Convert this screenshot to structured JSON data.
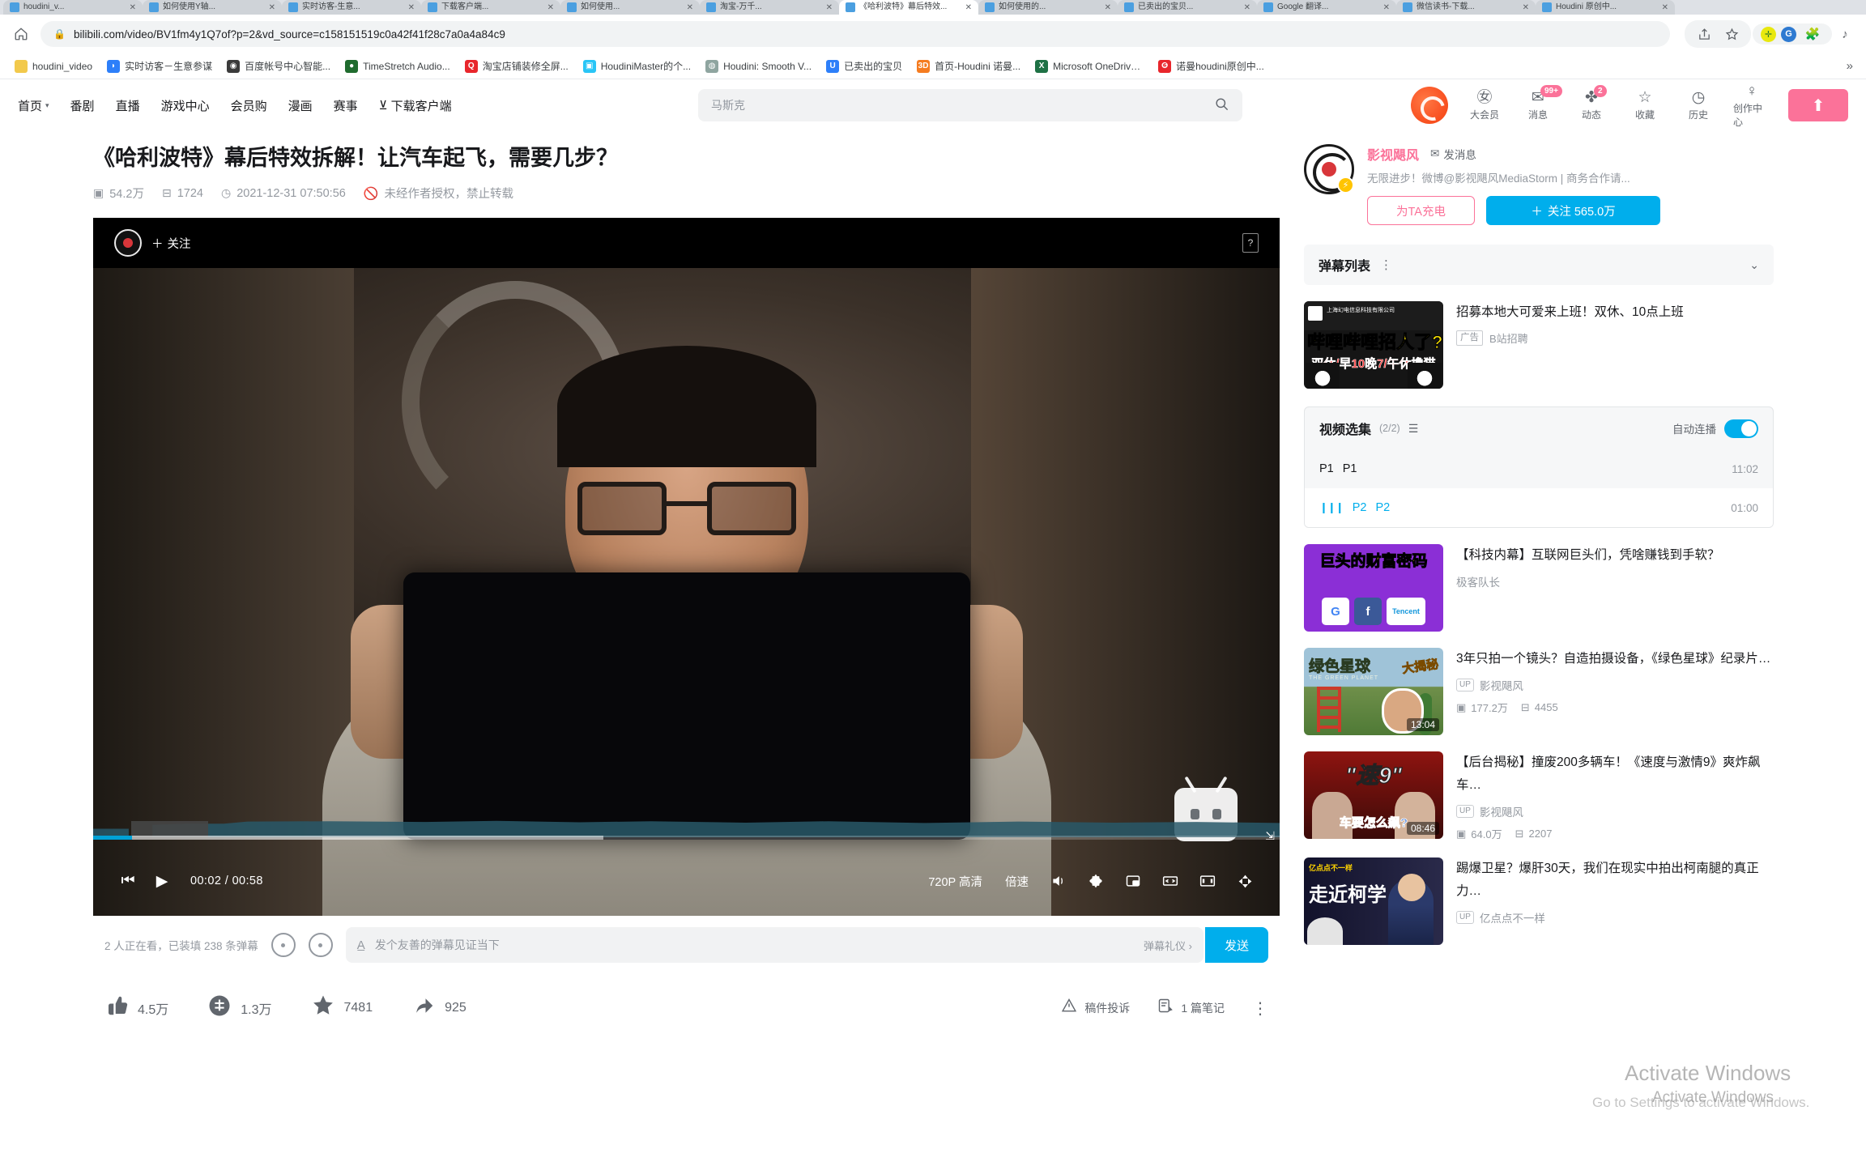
{
  "browser": {
    "tabs": [
      {
        "title": "houdini_v...",
        "active": false
      },
      {
        "title": "如何使用Y轴...",
        "active": false
      },
      {
        "title": "实时访客-生意...",
        "active": false
      },
      {
        "title": "下载客户端...",
        "active": false
      },
      {
        "title": "如何使用...",
        "active": false
      },
      {
        "title": "淘宝-万千...",
        "active": false
      },
      {
        "title": "《哈利波特》幕后特效...",
        "active": true
      },
      {
        "title": "如何使用的...",
        "active": false
      },
      {
        "title": "已卖出的宝贝...",
        "active": false
      },
      {
        "title": "Google 翻译...",
        "active": false
      },
      {
        "title": "微信读书-下载...",
        "active": false
      },
      {
        "title": "Houdini 原创中...",
        "active": false
      }
    ],
    "url": "bilibili.com/video/BV1fm4y1Q7of?p=2&vd_source=c158151519c0a42f41f28c7a0a4a84c9",
    "bookmarks": [
      {
        "label": "houdini_video",
        "color": "#f2c94c",
        "glyph": ""
      },
      {
        "label": "实时访客－生意参谋",
        "color": "#2d7ff9",
        "glyph": "◗"
      },
      {
        "label": "百度帐号中心智能...",
        "color": "#3b3b3b",
        "glyph": "◉"
      },
      {
        "label": "TimeStretch Audio...",
        "color": "#1f6b2e",
        "glyph": "●"
      },
      {
        "label": "淘宝店铺装修全屏...",
        "color": "#e8262c",
        "glyph": "Q"
      },
      {
        "label": "HoudiniMaster的个...",
        "color": "#29c5f6",
        "glyph": "▣"
      },
      {
        "label": "Houdini: Smooth V...",
        "color": "#8fa5a0",
        "glyph": "◍"
      },
      {
        "label": "已卖出的宝贝",
        "color": "#2d7ff9",
        "glyph": "U"
      },
      {
        "label": "首页-Houdini 诺曼...",
        "color": "#f57c20",
        "glyph": "3D"
      },
      {
        "label": "Microsoft OneDrive...",
        "color": "#1e7145",
        "glyph": "X"
      },
      {
        "label": "诺曼houdini原创中...",
        "color": "#e8262c",
        "glyph": "❻"
      }
    ],
    "overflow": "»"
  },
  "bili_header": {
    "nav": [
      {
        "label": "首页",
        "caret": true
      },
      {
        "label": "番剧",
        "caret": false
      },
      {
        "label": "直播",
        "caret": false
      },
      {
        "label": "游戏中心",
        "caret": false
      },
      {
        "label": "会员购",
        "caret": false
      },
      {
        "label": "漫画",
        "caret": false
      },
      {
        "label": "赛事",
        "caret": false
      }
    ],
    "download_label": "下载客户端",
    "search_value": "马斯克",
    "right_items": [
      {
        "label": "大会员",
        "glyph": "㊛",
        "badge": ""
      },
      {
        "label": "消息",
        "glyph": "✉",
        "badge": "99+"
      },
      {
        "label": "动态",
        "glyph": "✤",
        "badge": "2"
      },
      {
        "label": "收藏",
        "glyph": "☆",
        "badge": ""
      },
      {
        "label": "历史",
        "glyph": "◷",
        "badge": ""
      },
      {
        "label": "创作中心",
        "glyph": "♀",
        "badge": ""
      }
    ],
    "upload_glyph": "⬆"
  },
  "video": {
    "title": "《哈利波特》幕后特效拆解！让汽车起飞，需要几步？",
    "views": "54.2万",
    "danmaku": "1724",
    "date": "2021-12-31 07:50:56",
    "copyright": "未经作者授权，禁止转载",
    "player": {
      "follow_label": "关注",
      "help_glyph": "?",
      "time": "00:02 / 00:58",
      "quality": "720P 高清",
      "speed": "倍速",
      "prev_glyph": "⏮",
      "play_glyph": "▶",
      "volume_glyph": "🔊",
      "settings_glyph": "⚙",
      "pip_glyph": "❐",
      "widescreen_glyph": "◫",
      "webfull_glyph": "⛶",
      "fullscreen_glyph": "⤢"
    },
    "danmaku_bar": {
      "count_text": "2 人正在看，已装填 238 条弹幕",
      "placeholder": "发个友善的弹幕见证当下",
      "etiquette": "弹幕礼仪 ›",
      "send_label": "发送"
    },
    "actions": [
      {
        "name": "like",
        "glyph": "👍",
        "value": "4.5万"
      },
      {
        "name": "coin",
        "glyph": "币",
        "value": "1.3万"
      },
      {
        "name": "favorite",
        "glyph": "★",
        "value": "7481"
      },
      {
        "name": "share",
        "glyph": "➦",
        "value": "925"
      }
    ],
    "actions_right": [
      {
        "name": "report",
        "glyph": "⚠",
        "label": "稿件投诉"
      },
      {
        "name": "note",
        "glyph": "🗒",
        "label": "1 篇笔记"
      },
      {
        "name": "more",
        "glyph": "⋮",
        "label": ""
      }
    ]
  },
  "uploader": {
    "name": "影视飓风",
    "message_label": "发消息",
    "signature": "无限进步！微博@影视飓风MediaStorm | 商务合作请...",
    "charge_label": "为TA充电",
    "follow_label": "关注 565.0万",
    "badge_glyph": "⚡"
  },
  "danmaku_list": {
    "title": "弹幕列表",
    "dots": "⋮",
    "chevron": "⌄"
  },
  "ad": {
    "title": "招募本地大可爱来上班！双休、10点上班",
    "tag": "广告",
    "source": "B站招聘",
    "thumb_company": "上海幻电信息科技有限公司",
    "thumb_yellow": "哔哩哔哩招人了?",
    "thumb_red": "双休/早10晚7/午休撸猫"
  },
  "playlist": {
    "title": "视频选集",
    "count": "(2/2)",
    "list_icon": "☰",
    "auto_label": "自动连播",
    "items": [
      {
        "index": "P1",
        "name": "P1",
        "duration": "11:02",
        "active": false
      },
      {
        "index": "P2",
        "name": "P2",
        "duration": "01:00",
        "active": true
      }
    ]
  },
  "recommend": [
    {
      "title": "【科技内幕】互联网巨头们，凭啥赚钱到手软？",
      "up": "极客队长",
      "show_up_tag": false,
      "views": "",
      "danmaku": "",
      "duration": "",
      "thumb_class": "th-giants",
      "thumb_title": "巨头的财富密码",
      "thumb_logos": [
        "G",
        "f",
        "Tencent"
      ]
    },
    {
      "title": "3年只拍一个镜头？自造拍摄设备，《绿色星球》纪录片…",
      "up": "影视飓风",
      "show_up_tag": true,
      "views": "177.2万",
      "danmaku": "4455",
      "duration": "13:04",
      "thumb_class": "th-green",
      "thumb_title": "绿色星球",
      "thumb_sub": "THE GREEN PLANET",
      "thumb_badge": "大揭秘"
    },
    {
      "title": "【后台揭秘】撞废200多辆车！《速度与激情9》爽炸飙车…",
      "up": "影视飓风",
      "show_up_tag": true,
      "views": "64.0万",
      "danmaku": "2207",
      "duration": "08:46",
      "thumb_class": "th-fast",
      "thumb_title": "\"速9\"",
      "thumb_sub": "车要怎么飙?"
    },
    {
      "title": "踢爆卫星？爆肝30天，我们在现实中拍出柯南腿的真正力…",
      "up": "亿点点不一样",
      "show_up_tag": true,
      "views": "",
      "danmaku": "",
      "duration": "",
      "thumb_class": "th-conan",
      "thumb_title": "走近柯学",
      "thumb_small": "亿点点不一样"
    }
  ],
  "watermark": {
    "line1": "Activate Windows",
    "line2": "Go to Settings to activate Windows.",
    "line3": "Activate Windows"
  },
  "colors": {
    "bili_pink": "#fb7299",
    "bili_blue": "#00aeec",
    "progress_blue": "#00a1d6"
  }
}
